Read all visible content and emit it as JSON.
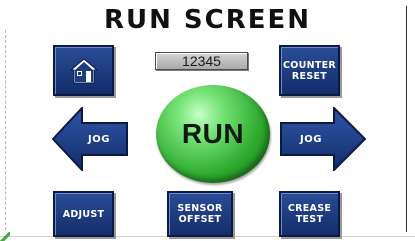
{
  "title": "RUN SCREEN",
  "counter_display": {
    "value": "12345"
  },
  "run_button": {
    "label": "RUN"
  },
  "buttons": {
    "home": {
      "icon": "home-icon"
    },
    "counter_reset": {
      "line1": "COUNTER",
      "line2": "RESET"
    },
    "jog_left": {
      "label": "JOG",
      "icon": "left-arrow-icon"
    },
    "jog_right": {
      "label": "JOG",
      "icon": "right-arrow-icon"
    },
    "adjust": {
      "label": "ADJUST"
    },
    "sensor_offset": {
      "line1": "SENSOR",
      "line2": "OFFSET"
    },
    "crease_test": {
      "line1": "CREASE",
      "line2": "TEST"
    }
  },
  "colors": {
    "button_blue": "#1e3c82",
    "button_border": "#0b1a44",
    "run_green": "#2faa2f",
    "display_gray": "#bdbdbd",
    "title": "#111111"
  }
}
